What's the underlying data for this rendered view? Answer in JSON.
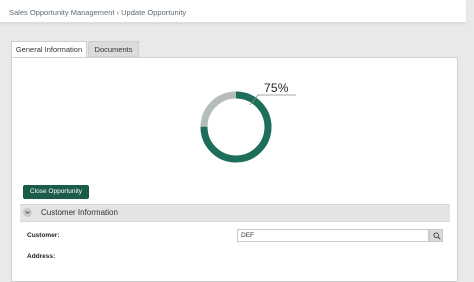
{
  "breadcrumb": {
    "text": "Sales Opportunity Management › Update Opportunity"
  },
  "tabs": [
    {
      "label": "General Information",
      "active": true
    },
    {
      "label": "Documents",
      "active": false
    }
  ],
  "progress": {
    "label": "75%",
    "value": 0.75,
    "colors": {
      "fill": "#1e6e5c",
      "track": "#b5bdbb"
    }
  },
  "actions": {
    "close_label": "Close Opportunity"
  },
  "section": {
    "title": "Customer Information",
    "toggle_icon": "chevron-down-icon"
  },
  "fields": {
    "customer": {
      "label": "Customer:",
      "value": "DEF",
      "lookup_icon": "search-icon"
    },
    "address": {
      "label": "Address:"
    }
  },
  "colors": {
    "accent": "#1c5b4a",
    "background": "#e9e9e9",
    "panel": "#ffffff"
  }
}
